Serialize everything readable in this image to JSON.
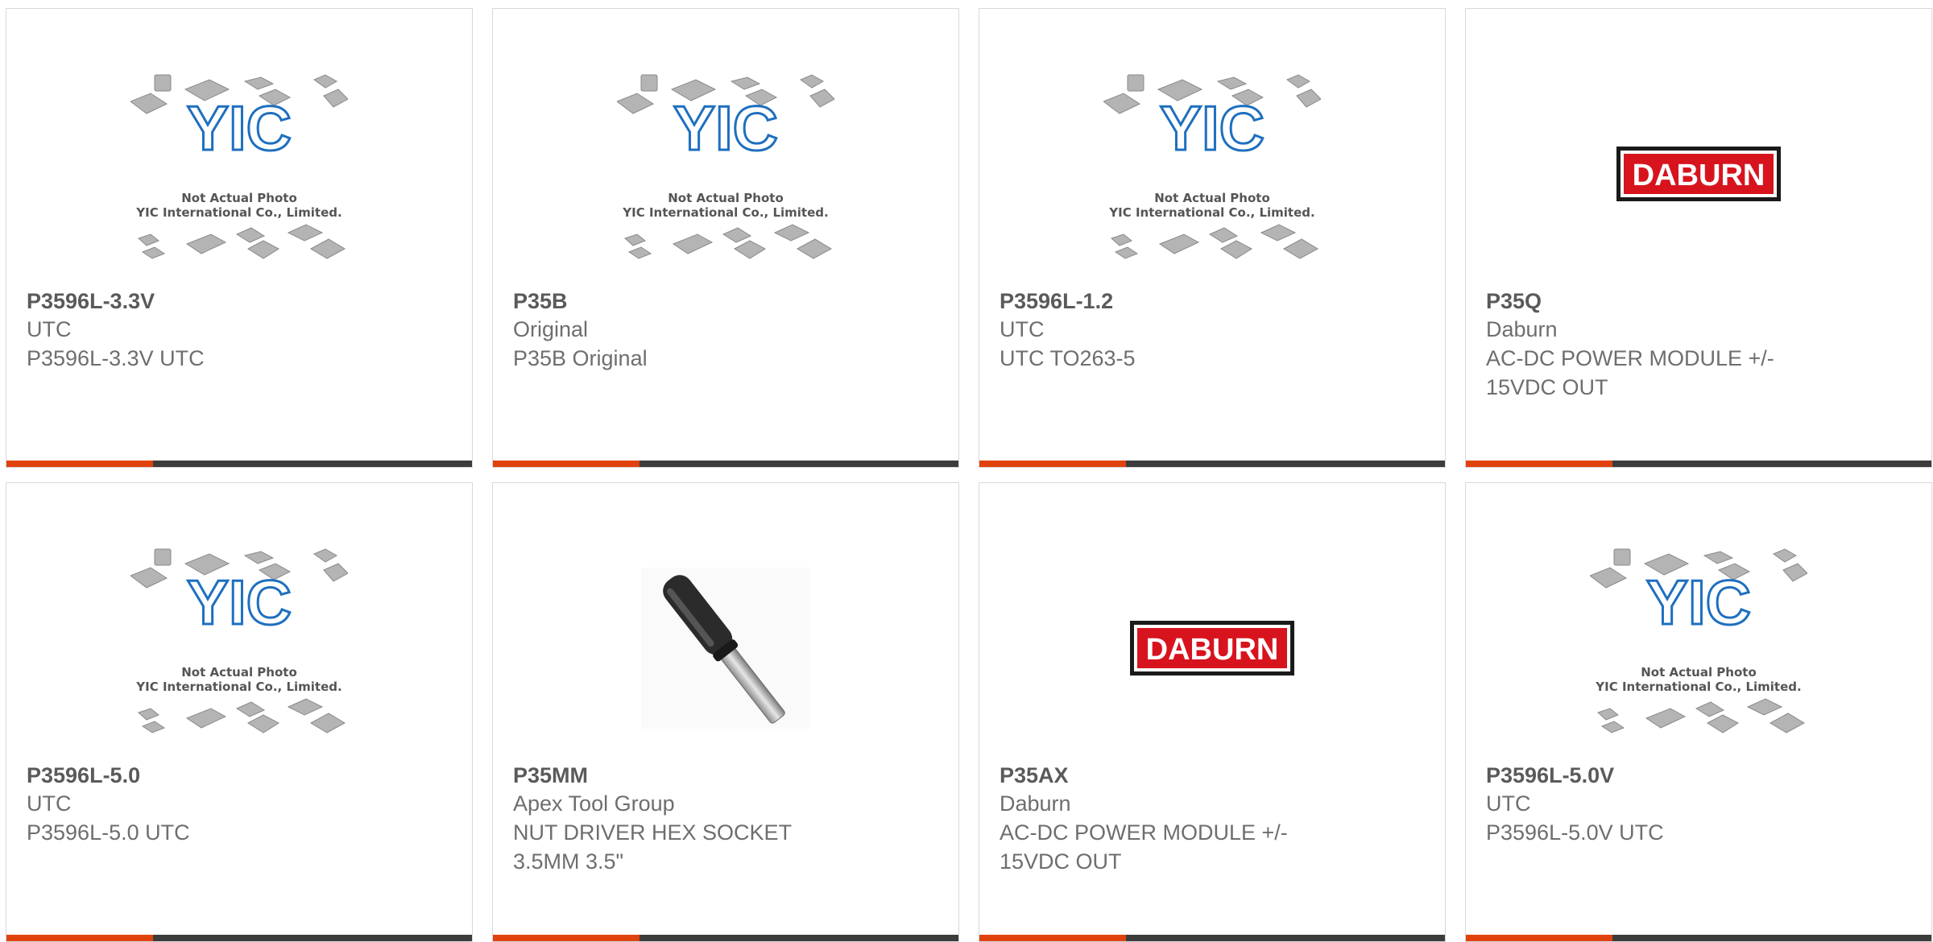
{
  "products": [
    {
      "part_number": "P3596L-3.3V",
      "manufacturer": "UTC",
      "description": "P3596L-3.3V UTC",
      "image": "yic-placeholder"
    },
    {
      "part_number": "P35B",
      "manufacturer": "Original",
      "description": "P35B Original",
      "image": "yic-placeholder"
    },
    {
      "part_number": "P3596L-1.2",
      "manufacturer": "UTC",
      "description": "UTC TO263-5",
      "image": "yic-placeholder"
    },
    {
      "part_number": "P35Q",
      "manufacturer": "Daburn",
      "description": "AC-DC POWER MODULE +/- 15VDC OUT",
      "image": "daburn-logo"
    },
    {
      "part_number": "P3596L-5.0",
      "manufacturer": "UTC",
      "description": "P3596L-5.0 UTC",
      "image": "yic-placeholder"
    },
    {
      "part_number": "P35MM",
      "manufacturer": "Apex Tool Group",
      "description": "NUT DRIVER HEX SOCKET 3.5MM 3.5\"",
      "image": "nut-driver-photo"
    },
    {
      "part_number": "P35AX",
      "manufacturer": "Daburn",
      "description": "AC-DC POWER MODULE +/- 15VDC OUT",
      "image": "daburn-logo"
    },
    {
      "part_number": "P3596L-5.0V",
      "manufacturer": "UTC",
      "description": "P3596L-5.0V UTC",
      "image": "yic-placeholder"
    }
  ],
  "placeholder": {
    "logo_text": "YIC",
    "line1": "Not Actual Photo",
    "line2": "YIC International Co., Limited."
  },
  "daburn_logo_text": "DABURN",
  "colors": {
    "accent": "#e0420e",
    "bar": "#3c3c3c",
    "border": "#d9d9d9",
    "yic_blue": "#1e6fbf",
    "daburn_red": "#d7141e"
  }
}
